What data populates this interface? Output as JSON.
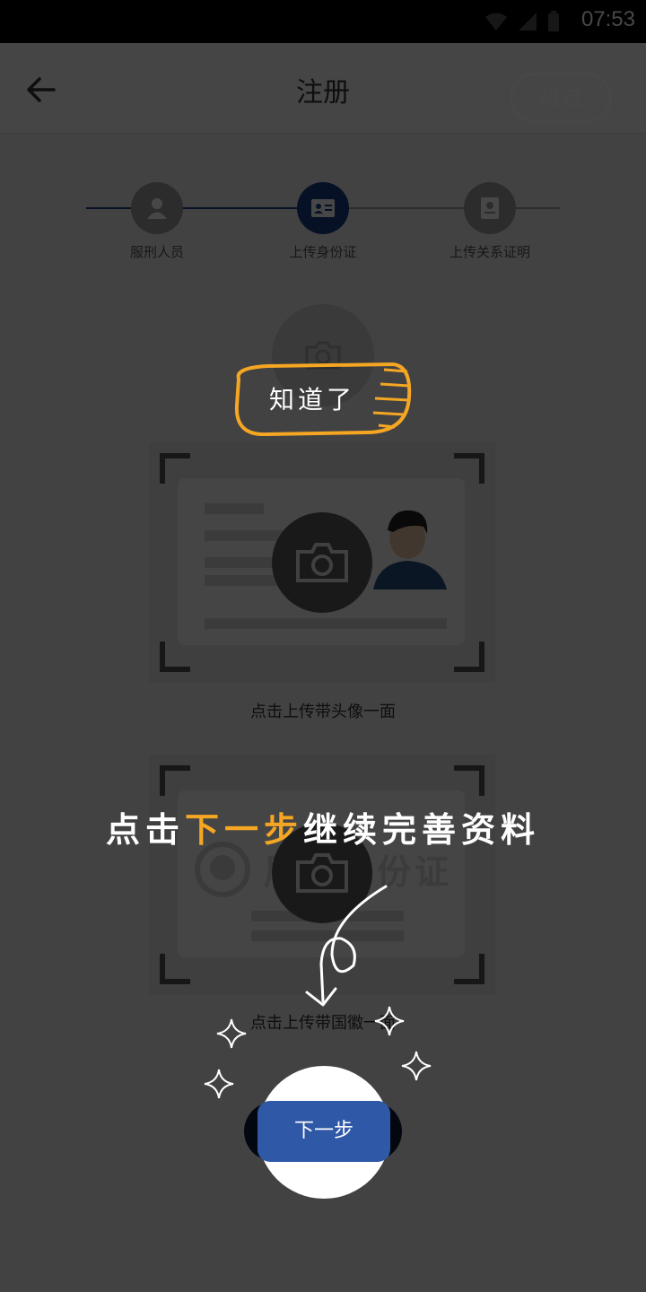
{
  "status_bar": {
    "time": "07:53"
  },
  "header": {
    "title": "注册",
    "skip_label": "跳过"
  },
  "steps": [
    {
      "label": "服刑人员",
      "active": false
    },
    {
      "label": "上传身份证",
      "active": true
    },
    {
      "label": "上传关系证明",
      "active": false
    }
  ],
  "upload": {
    "front_caption": "点击上传带头像一面",
    "back_caption": "点击上传带国徽一面",
    "back_card_text": "居民身份证"
  },
  "next_button": {
    "label": "下一步"
  },
  "guide": {
    "got_it_label": "知道了",
    "tip_prefix": "点击",
    "tip_highlight": "下一步",
    "tip_suffix": "继续完善资料",
    "highlight_color": "#f5a623"
  },
  "colors": {
    "primary": "#2f58a6",
    "step_active": "#1b3f86"
  }
}
